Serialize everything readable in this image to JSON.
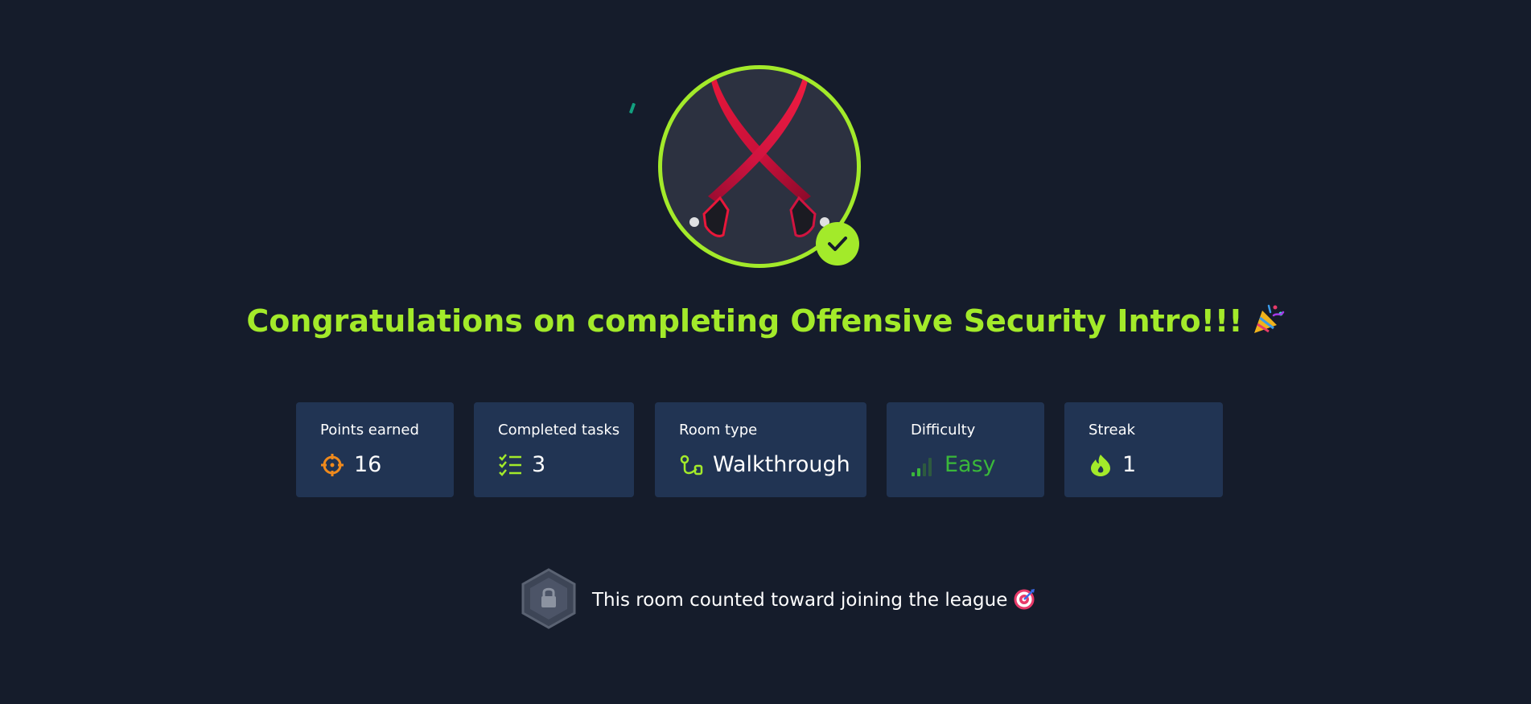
{
  "title": "Congratulations on completing Offensive Security Intro!!!",
  "title_emoji": "party-popper-icon",
  "badge": {
    "icon": "crossed-swords-icon",
    "status_icon": "check-icon"
  },
  "stats": [
    {
      "label": "Points earned",
      "value": "16",
      "icon": "crosshair-icon"
    },
    {
      "label": "Completed tasks",
      "value": "3",
      "icon": "checklist-icon"
    },
    {
      "label": "Room type",
      "value": "Walkthrough",
      "icon": "route-icon"
    },
    {
      "label": "Difficulty",
      "value": "Easy",
      "icon": "signal-bars-icon"
    },
    {
      "label": "Streak",
      "value": "1",
      "icon": "flame-icon"
    }
  ],
  "league": {
    "text": "This room counted toward joining the league",
    "icon": "locked-hexagon-icon",
    "emoji": "dart-icon"
  },
  "colors": {
    "background": "#151c2b",
    "accent": "#a3ea2a",
    "card": "#213453",
    "points_icon": "#f08a1c",
    "easy": "#3ab83a"
  }
}
